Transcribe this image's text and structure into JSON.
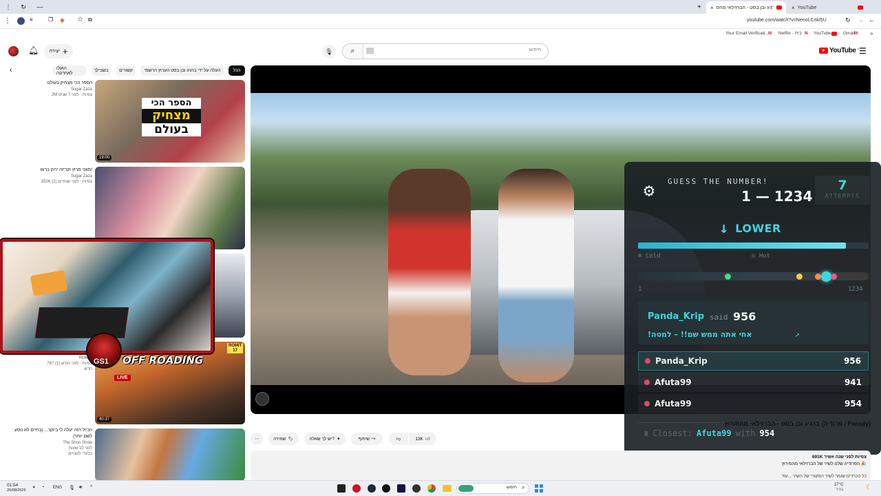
{
  "browser": {
    "tabs": [
      {
        "title": "YouTube",
        "active": false
      },
      {
        "title": "ברגיג ובן בסט - הברזילאי מהס",
        "active": true
      }
    ],
    "url": "youtube.com/watch?v=NenoLCnkI5U",
    "bookmarks": [
      "Your Email Verificati...",
      "Netflix - בית",
      "YouTube",
      "Gmail"
    ]
  },
  "youtube": {
    "logo": "YouTube",
    "logo_sup": "IL",
    "search_placeholder": "חיפוש",
    "search_value": "▒▒",
    "create_label": "יצירה"
  },
  "chips": [
    "הכל",
    "העלה על ידי ברגיג ובן בסט הערוץ הרשמי",
    "קשורים",
    "בשבילך",
    "הועלו לאחרונה"
  ],
  "sidebar_videos": [
    {
      "title": "הספר הכי מצחיק בעולם",
      "channel": "Sugar Zaza",
      "stats": "2M צפיות · לפני 7 שנים",
      "duration": "19:00",
      "thumb_text": [
        "הספר הכי",
        "מצחיק",
        "בעולם"
      ]
    },
    {
      "title": "מאני מרוץ וקריזה ירוק ברוגו!",
      "channel": "Sugar Zaza",
      "stats": "332K צפיות · לפני שנתיים (2)",
      "duration": ""
    },
    {
      "title": "",
      "channel": "ROMIT",
      "stats": "787 צפיות · לפני חודש (1)",
      "extra": "חדש",
      "duration": "",
      "badge": "ROMIT",
      "badge_sub": "17"
    },
    {
      "title": "OFF ROADING",
      "channel": "",
      "stats": "",
      "duration": "40:37",
      "live": "LIVE"
    },
    {
      "title": "הכיול הזה יעלה לי ביוקר... (בחיים לא נוסע לשם יותר)",
      "channel": "The Shon Show",
      "stats": "לפני 10 שעות",
      "extra": "בלעדי למנויים",
      "duration": ""
    }
  ],
  "overlay_cam": {
    "label": "GS1"
  },
  "game": {
    "title": "GUESS THE NUMBER!",
    "range_min": "1",
    "range_sep": "—",
    "range_max": "1234",
    "range_text": "1 — 1234",
    "attempts_value": "7",
    "attempts_label": "ATTEMPTS",
    "hint": "LOWER",
    "cold_label": "Cold",
    "hot_label": "Hot",
    "scale_min": "1",
    "scale_max": "1234",
    "heat_fraction": 0.9,
    "markers": [
      {
        "value": 0.39,
        "color": "#3ddc84"
      },
      {
        "value": 0.7,
        "color": "#f7c744"
      },
      {
        "value": 0.78,
        "color": "#ff8c42"
      },
      {
        "value": 0.815,
        "color": "#3fd5e0"
      },
      {
        "value": 0.85,
        "color": "#e85a8c"
      }
    ],
    "last_guess": {
      "user": "Panda_Krip",
      "said": "said",
      "value": "956",
      "message": "!אחי אתה ממש שם!! – למטה"
    },
    "leaderboard": [
      {
        "user": "Panda_Krip",
        "value": "956"
      },
      {
        "user": "Afuta99",
        "value": "941"
      },
      {
        "user": "Afuta99",
        "value": "954"
      }
    ],
    "closest_label": "Closest:",
    "closest_user": "Afuta99",
    "closest_with": "with",
    "closest_value": "954"
  },
  "video": {
    "title": "ברגיג ובן בסט - הברזילאי מהסורוץ (פרודיה / Parody)",
    "channel": "ברגיג ובן בסט הערוץ הרשמי",
    "subscribe": "הרשמה",
    "likes": "13K",
    "share": "שיתוף",
    "ask": "יש לך שאלה?",
    "save": "שמירה",
    "views": "691K צפיות לפני שנה #שיר",
    "desc1": "הפרודיה שלנו לשיר של הברזילאי מהמירוץ 🎉",
    "desc2": "כל הכרדים שומר לשיר המקורי של השיר ...עוד"
  },
  "taskbar": {
    "time": "01:54",
    "date": "26/08/2026",
    "lang": "ENG",
    "search": "חיפוש",
    "weather_temp": "27°C",
    "weather_text": "בהיר"
  }
}
